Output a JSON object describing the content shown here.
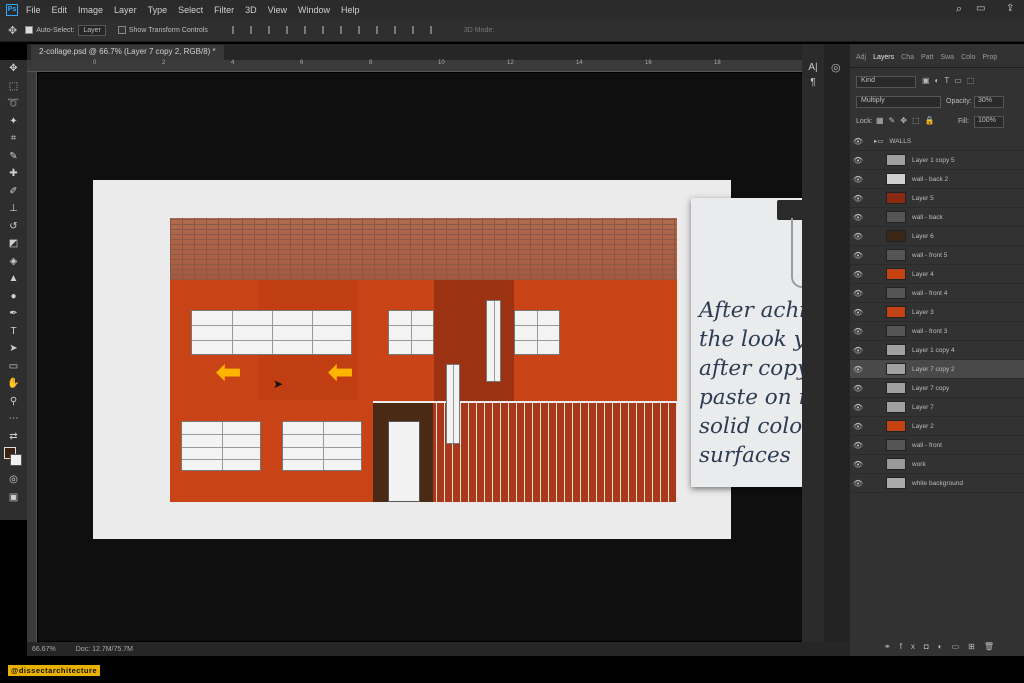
{
  "menubar": {
    "app_icon": "Ps",
    "items": [
      "File",
      "Edit",
      "Image",
      "Layer",
      "Type",
      "Select",
      "Filter",
      "3D",
      "View",
      "Window",
      "Help"
    ]
  },
  "options": {
    "auto_select_label": "Auto-Select:",
    "auto_select_value": "Layer",
    "transform_label": "Show Transform Controls",
    "mode_3d": "3D Mode:"
  },
  "document": {
    "tab_title": "2-collage.psd @ 66.7% (Layer 7 copy 2, RGB/8) *",
    "ruler_ticks": [
      "0",
      "2",
      "4",
      "6",
      "8",
      "10",
      "12",
      "14",
      "16",
      "18"
    ]
  },
  "note": {
    "text": "After achieving the look you are after copy and paste on rest of solid color surfaces"
  },
  "layers_panel": {
    "tabs": [
      "Adj",
      "Layers",
      "Cha",
      "Patt",
      "Swa",
      "Colo",
      "Prop"
    ],
    "active_tab": "Layers",
    "kind_label": "Kind",
    "blend_mode": "Multiply",
    "opacity_label": "Opacity:",
    "opacity_value": "30%",
    "lock_label": "Lock:",
    "fill_label": "Fill:",
    "fill_value": "100%",
    "layers": [
      {
        "name": "WALLS",
        "type": "group",
        "thumb": "#666"
      },
      {
        "name": "Layer 1 copy 5",
        "type": "layer",
        "thumb": "#a0a0a0"
      },
      {
        "name": "wall - back 2",
        "type": "layer",
        "thumb": "#cfcfcf"
      },
      {
        "name": "Layer 5",
        "type": "layer",
        "thumb": "#8a2a12"
      },
      {
        "name": "wall - back",
        "type": "layer",
        "thumb": "#555"
      },
      {
        "name": "Layer 6",
        "type": "layer",
        "thumb": "#3a2616"
      },
      {
        "name": "wall - front 5",
        "type": "layer",
        "thumb": "#555"
      },
      {
        "name": "Layer 4",
        "type": "layer",
        "thumb": "#c44314"
      },
      {
        "name": "wall - front 4",
        "type": "layer",
        "thumb": "#555"
      },
      {
        "name": "Layer 3",
        "type": "layer",
        "thumb": "#c44314"
      },
      {
        "name": "wall - front 3",
        "type": "layer",
        "thumb": "#555"
      },
      {
        "name": "Layer 1 copy 4",
        "type": "layer",
        "thumb": "#a0a0a0"
      },
      {
        "name": "Layer 7 copy 2",
        "type": "layer",
        "thumb": "#a0a0a0",
        "selected": true
      },
      {
        "name": "Layer 7 copy",
        "type": "layer",
        "thumb": "#a0a0a0"
      },
      {
        "name": "Layer 7",
        "type": "layer",
        "thumb": "#a0a0a0"
      },
      {
        "name": "Layer 2",
        "type": "layer",
        "thumb": "#c44314"
      },
      {
        "name": "wall - front",
        "type": "layer",
        "thumb": "#555"
      },
      {
        "name": "work",
        "type": "layer",
        "thumb": "#999"
      },
      {
        "name": "white background",
        "type": "layer",
        "thumb": "#aaa"
      }
    ]
  },
  "status": {
    "zoom": "66.67%",
    "doc": "Doc: 12.7M/75.7M"
  },
  "watermark": "@dissectarchitecture",
  "colors": {
    "accent_arrow": "#ffb400",
    "wall_orange": "#c84316",
    "watermark_bg": "#e8b000"
  }
}
